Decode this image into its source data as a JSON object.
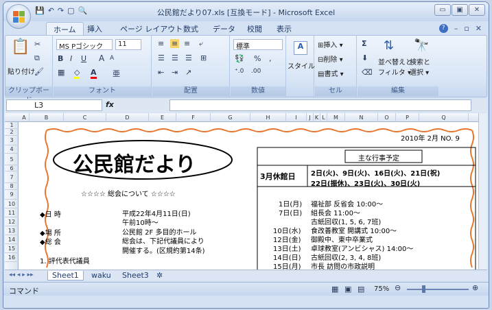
{
  "window": {
    "title": "公民館だより07.xls [互換モード] - Microsoft Excel",
    "min": "▭",
    "max": "▣",
    "close": "✕"
  },
  "qat": {
    "save": "💾",
    "undo": "↶",
    "redo": "↷",
    "print": "▢",
    "preview": "🔍"
  },
  "tabs": [
    "ホーム",
    "挿入",
    "ページ レイアウト",
    "数式",
    "データ",
    "校閲",
    "表示"
  ],
  "tab_right": {
    "help": "?",
    "min": "–",
    "restore": "▫",
    "close": "✕"
  },
  "ribbon": {
    "clipboard": {
      "paste": "貼り付け",
      "label": "クリップボード"
    },
    "font": {
      "name": "MS Pゴシック",
      "size": "11",
      "bold": "B",
      "italic": "I",
      "underline": "U",
      "grow": "A",
      "shrink": "A",
      "label": "フォント"
    },
    "align": {
      "label": "配置"
    },
    "number": {
      "format": "標準",
      "pct": "%",
      "comma": ",",
      "label": "数値"
    },
    "style": {
      "name": "スタイル"
    },
    "cells": {
      "insert": "挿入",
      "delete": "削除",
      "format": "書式",
      "label": "セル"
    },
    "edit": {
      "sum": "Σ",
      "sort": "並べ替えと",
      "sort2": "フィルタ",
      "find": "検索と",
      "find2": "選択",
      "label": "編集"
    }
  },
  "formula": {
    "cell": "L3",
    "fx": "fx",
    "value": ""
  },
  "columns": [
    "A",
    "B",
    "C",
    "D",
    "E",
    "F",
    "G",
    "H",
    "I",
    "J",
    "K",
    "L",
    "M",
    "N",
    "O",
    "P",
    "Q"
  ],
  "rows": [
    "1",
    "2",
    "3",
    "4",
    "5",
    "6",
    "7",
    "8",
    "9",
    "10",
    "11",
    "12",
    "13",
    "14",
    "15",
    "16"
  ],
  "doc": {
    "date": "2010年 2月  NO. 9",
    "title": "公民館だより",
    "schedule_header": "主な行事予定",
    "closed_label": "3月休館日",
    "closed_line1": "2日(火)、9日(火)、16日(火)、21日(祝)",
    "closed_line2": "22日(振休)、23日(火)、30日(火)",
    "general": "☆☆☆☆ 総会について ☆☆☆☆",
    "r_datetime": "◆日 時",
    "v_datetime1": "平成22年4月11日(日)",
    "v_datetime2": "午前10時～",
    "r_place": "◆場 所",
    "v_place": "公民館 2F 多目的ホール",
    "r_meeting": "◆総 会",
    "v_meeting1": "総会は、下記代議員により",
    "v_meeting2": "開催する。(区規約第14条)",
    "cut": "1. 評代表代議員",
    "events": [
      {
        "d": "1日(月)",
        "e": "福祉部 反省会 10:00～"
      },
      {
        "d": "7日(日)",
        "e": "組長会 11:00～"
      },
      {
        "d": "",
        "e": "古紙回収(1, 5, 6, 7班)"
      },
      {
        "d": "10日(水)",
        "e": "食改善教室 開講式 10:00～"
      },
      {
        "d": "12日(金)",
        "e": "御殿中、東中卒業式"
      },
      {
        "d": "13日(土)",
        "e": "卓球教室(アンビシャス) 14:00～"
      },
      {
        "d": "14日(日)",
        "e": "古紙回収(2, 3, 4, 8班)"
      },
      {
        "d": "15日(月)",
        "e": "市長 訪問の市政説明"
      }
    ]
  },
  "sheets": [
    "Sheet1",
    "waku",
    "Sheet3"
  ],
  "status": {
    "mode": "コマンド",
    "zoom": "75%"
  }
}
